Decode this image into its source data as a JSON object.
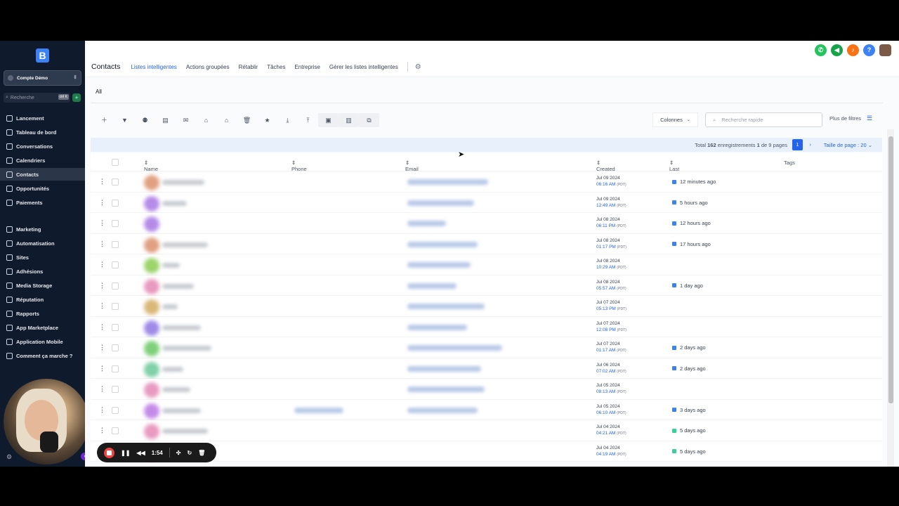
{
  "sidebar": {
    "logo": "B",
    "account": "Compte Démo",
    "search_placeholder": "Recherche",
    "search_shortcut": "ctrl K",
    "items": [
      {
        "label": "Lancement",
        "active": false
      },
      {
        "label": "Tableau de bord",
        "active": false
      },
      {
        "label": "Conversations",
        "active": false
      },
      {
        "label": "Calendriers",
        "active": false
      },
      {
        "label": "Contacts",
        "active": true
      },
      {
        "label": "Opportunités",
        "active": false
      },
      {
        "label": "Paiements",
        "active": false
      },
      {
        "label": "Marketing",
        "active": false
      },
      {
        "label": "Automatisation",
        "active": false
      },
      {
        "label": "Sites",
        "active": false
      },
      {
        "label": "Adhésions",
        "active": false
      },
      {
        "label": "Media Storage",
        "active": false
      },
      {
        "label": "Réputation",
        "active": false
      },
      {
        "label": "Rapports",
        "active": false
      },
      {
        "label": "App Marketplace",
        "active": false
      },
      {
        "label": "Application Mobile",
        "active": false
      },
      {
        "label": "Comment ça marche ?",
        "active": false
      }
    ]
  },
  "header": {
    "title": "Contacts",
    "tabs": [
      "Listes intelligentes",
      "Actions groupées",
      "Rétablir",
      "Tâches",
      "Entreprise",
      "Gérer les listes intelligentes"
    ],
    "selected_tab": "Listes intelligentes"
  },
  "content": {
    "subtab": "All",
    "columns_button": "Colonnes",
    "search_placeholder": "Recherche rapide",
    "more_filters": "Plus de filtres",
    "pager": {
      "total_prefix": "Total",
      "total": "162",
      "records_label": "enregistrements",
      "page": "1",
      "of_label": "de",
      "pages": "9",
      "pages_label": "pages",
      "page_size_label": "Taille de page : 20"
    },
    "headers": {
      "name": "Name",
      "phone": "Phone",
      "email": "Email",
      "created": "Created",
      "activity": "Last Activity",
      "tags": "Tags"
    },
    "rows": [
      {
        "date": "Jul 09 2024",
        "time": "06:16 AM",
        "tz": "(PDT)",
        "activity": "12 minutes ago",
        "icon": "mail"
      },
      {
        "date": "Jul 09 2024",
        "time": "12:49 AM",
        "tz": "(PDT)",
        "activity": "5 hours ago",
        "icon": "mail"
      },
      {
        "date": "Jul 08 2024",
        "time": "06:11 PM",
        "tz": "(PDT)",
        "activity": "12 hours ago",
        "icon": "mail"
      },
      {
        "date": "Jul 08 2024",
        "time": "01:17 PM",
        "tz": "(PDT)",
        "activity": "17 hours ago",
        "icon": "mail"
      },
      {
        "date": "Jul 08 2024",
        "time": "10:29 AM",
        "tz": "(PDT)",
        "activity": "",
        "icon": ""
      },
      {
        "date": "Jul 08 2024",
        "time": "05:57 AM",
        "tz": "(PDT)",
        "activity": "1 day ago",
        "icon": "mail"
      },
      {
        "date": "Jul 07 2024",
        "time": "05:13 PM",
        "tz": "(PDT)",
        "activity": "",
        "icon": ""
      },
      {
        "date": "Jul 07 2024",
        "time": "12:08 PM",
        "tz": "(PDT)",
        "activity": "",
        "icon": ""
      },
      {
        "date": "Jul 07 2024",
        "time": "01:17 AM",
        "tz": "(PDT)",
        "activity": "2 days ago",
        "icon": "mail"
      },
      {
        "date": "Jul 06 2024",
        "time": "07:02 AM",
        "tz": "(PDT)",
        "activity": "2 days ago",
        "icon": "mail"
      },
      {
        "date": "Jul 05 2024",
        "time": "08:13 AM",
        "tz": "(PDT)",
        "activity": "",
        "icon": ""
      },
      {
        "date": "Jul 05 2024",
        "time": "06:10 AM",
        "tz": "(PDT)",
        "activity": "3 days ago",
        "icon": "mail"
      },
      {
        "date": "Jul 04 2024",
        "time": "04:21 AM",
        "tz": "(PDT)",
        "activity": "5 days ago",
        "icon": "sms"
      },
      {
        "date": "Jul 04 2024",
        "time": "04:19 AM",
        "tz": "(PDT)",
        "activity": "5 days ago",
        "icon": "sms"
      }
    ]
  },
  "recorder": {
    "timer": "1:54"
  }
}
